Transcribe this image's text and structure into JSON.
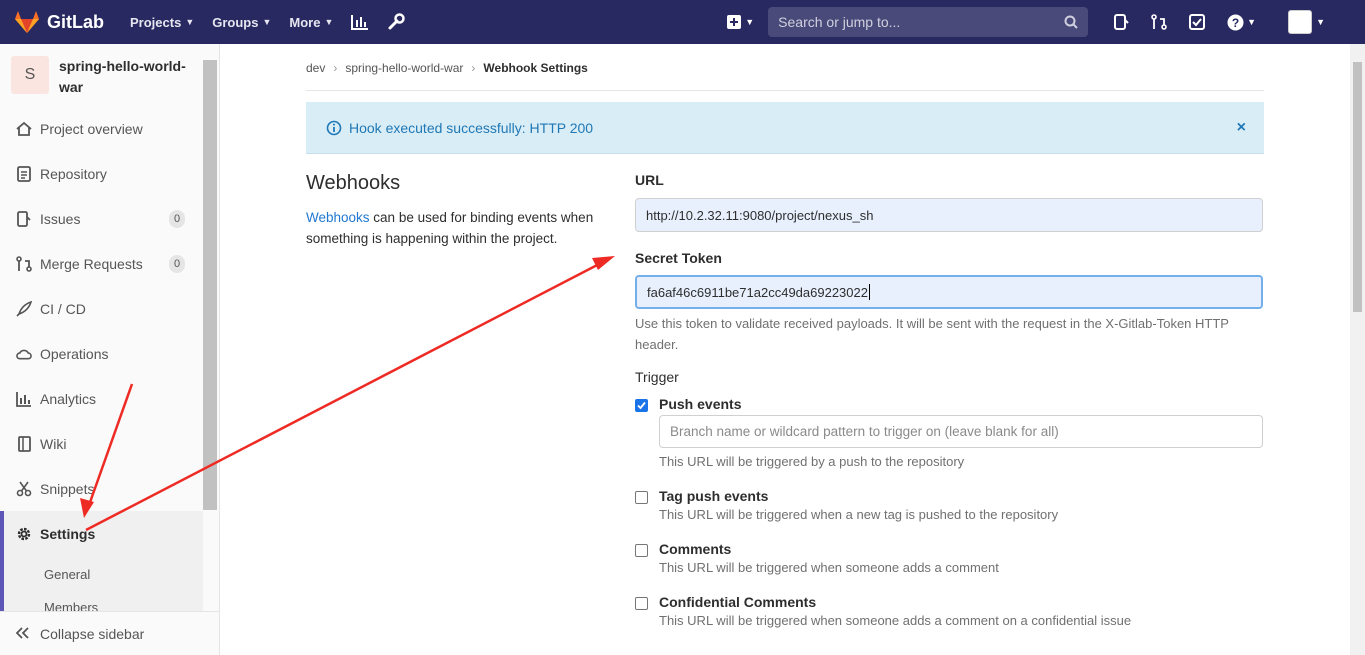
{
  "navbar": {
    "brand": "GitLab",
    "menu": [
      {
        "label": "Projects"
      },
      {
        "label": "Groups"
      },
      {
        "label": "More"
      }
    ],
    "search_placeholder": "Search or jump to...",
    "bg_color": "#292961"
  },
  "sidebar": {
    "project_avatar": "S",
    "project_name": "spring-hello-world-war",
    "items": [
      {
        "label": "Project overview",
        "icon": "home-icon"
      },
      {
        "label": "Repository",
        "icon": "doc-icon"
      },
      {
        "label": "Issues",
        "icon": "issues-icon",
        "count": "0"
      },
      {
        "label": "Merge Requests",
        "icon": "merge-request-icon",
        "count": "0"
      },
      {
        "label": "CI / CD",
        "icon": "rocket-icon"
      },
      {
        "label": "Operations",
        "icon": "cloud-icon"
      },
      {
        "label": "Analytics",
        "icon": "chart-icon"
      },
      {
        "label": "Wiki",
        "icon": "book-icon"
      },
      {
        "label": "Snippets",
        "icon": "scissors-icon"
      },
      {
        "label": "Settings",
        "icon": "gear-icon"
      }
    ],
    "sub_items": [
      {
        "label": "General"
      },
      {
        "label": "Members"
      }
    ],
    "collapse_label": "Collapse sidebar"
  },
  "breadcrumb": {
    "items": [
      "dev",
      "spring-hello-world-war",
      "Webhook Settings"
    ]
  },
  "alert": {
    "message": "Hook executed successfully: HTTP 200",
    "close": "×"
  },
  "webhooks": {
    "title": "Webhooks",
    "link_text": "Webhooks",
    "description": " can be used for binding events when something is happening within the project."
  },
  "form": {
    "url_label": "URL",
    "url_value": "http://10.2.32.11:9080/project/nexus_sh",
    "token_label": "Secret Token",
    "token_value": "fa6af46c6911be71a2cc49da69223022",
    "token_help": "Use this token to validate received payloads. It will be sent with the request in the X-Gitlab-Token HTTP header.",
    "trigger_label": "Trigger",
    "triggers": [
      {
        "title": "Push events",
        "checked": true,
        "help": "This URL will be triggered by a push to the repository",
        "branch_placeholder": "Branch name or wildcard pattern to trigger on (leave blank for all)"
      },
      {
        "title": "Tag push events",
        "checked": false,
        "help": "This URL will be triggered when a new tag is pushed to the repository"
      },
      {
        "title": "Comments",
        "checked": false,
        "help": "This URL will be triggered when someone adds a comment"
      },
      {
        "title": "Confidential Comments",
        "checked": false,
        "help": "This URL will be triggered when someone adds a comment on a confidential issue"
      }
    ]
  },
  "annotation_color": "#ee2a24"
}
